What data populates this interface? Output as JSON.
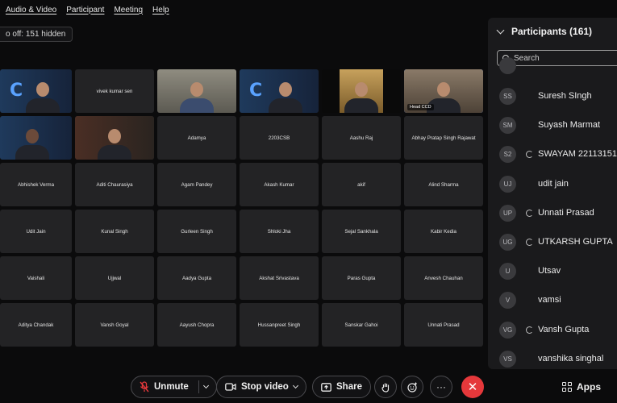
{
  "menu": [
    "Audio & Video",
    "Participant",
    "Meeting",
    "Help"
  ],
  "hidden_notice": "o off: 151 hidden",
  "video_tiles": [
    {
      "name": "",
      "label": "",
      "type": "logo"
    },
    {
      "name": "vivek kumar sen",
      "label": "",
      "type": "name"
    },
    {
      "name": "",
      "label": "",
      "type": "person"
    },
    {
      "name": "",
      "label": "",
      "type": "logo"
    },
    {
      "name": "",
      "label": "",
      "type": "person"
    },
    {
      "name": "",
      "label": "Head CCD",
      "type": "person-active"
    },
    {
      "name": "",
      "label": "",
      "type": "person"
    },
    {
      "name": "",
      "label": "",
      "type": "person"
    }
  ],
  "name_tiles": [
    "Adamya",
    "2203CSB",
    "Aashu Raj",
    "Abhay Pratap Singh Rajawat",
    "Abhishek Verma",
    "Aditi Chaurasiya",
    "Agam Pandey",
    "Akash Kumar",
    "akif",
    "Alind Sharma",
    "Udit Jain",
    "Kunal Singh",
    "Gurleen Singh",
    "Shloki Jha",
    "Sejal Sankhala",
    "Kabir Kedia",
    "Vaishali",
    "Ujjwal",
    "Aadya Gupta",
    "Akshat Srivastava",
    "Paras Gupta",
    "Anvesh Chauhan",
    "Aditya Chandak",
    "Vansh Goyal",
    "Aayush Chopra",
    "Hussanpreet Singh",
    "Sanskar Gahoi",
    "Unnati Prasad"
  ],
  "panel": {
    "title": "Participants (161)",
    "search_placeholder": "Search",
    "participants": [
      {
        "initials": "",
        "name": "",
        "ring": false
      },
      {
        "initials": "SS",
        "name": "Suresh SIngh",
        "ring": false
      },
      {
        "initials": "SM",
        "name": "Suyash Marmat",
        "ring": false
      },
      {
        "initials": "S2",
        "name": "SWAYAM 22113151",
        "ring": true
      },
      {
        "initials": "UJ",
        "name": "udit jain",
        "ring": false
      },
      {
        "initials": "UP",
        "name": "Unnati Prasad",
        "ring": true
      },
      {
        "initials": "UG",
        "name": "UTKARSH GUPTA",
        "ring": true
      },
      {
        "initials": "U",
        "name": "Utsav",
        "ring": false
      },
      {
        "initials": "V",
        "name": "vamsi",
        "ring": false
      },
      {
        "initials": "VG",
        "name": "Vansh Gupta",
        "ring": true
      },
      {
        "initials": "VS",
        "name": "vanshika singhal",
        "ring": false
      }
    ]
  },
  "controls": {
    "unmute": "Unmute",
    "stop_video": "Stop video",
    "share": "Share",
    "apps": "Apps",
    "leave_symbol": "✕",
    "more_symbol": "···"
  },
  "colors": {
    "active_border": "#3b82f6",
    "leave": "#e5383b"
  }
}
